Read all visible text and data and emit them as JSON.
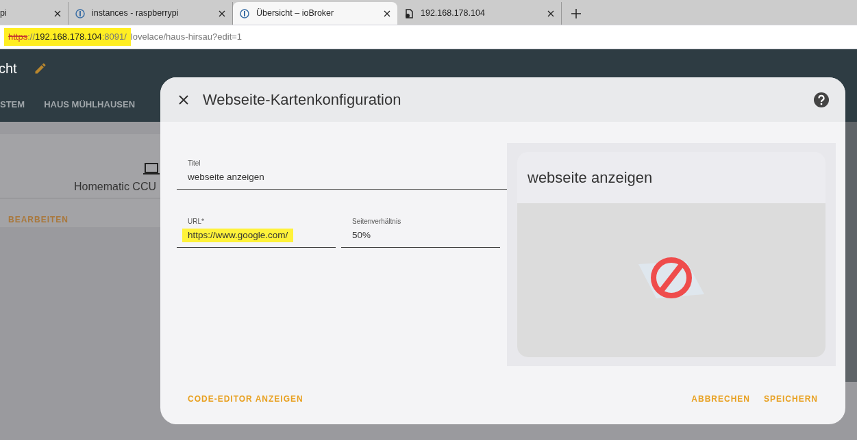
{
  "browser_tabs": [
    {
      "title": "pi",
      "selected": false
    },
    {
      "title": "instances - raspberrypi",
      "kind": "site",
      "selected": false
    },
    {
      "title": "Übersicht – ioBroker",
      "kind": "site",
      "selected": true
    },
    {
      "title": "192.168.178.104",
      "kind": "file",
      "selected": false
    }
  ],
  "address_bar": {
    "scheme": "https",
    "separator": "://",
    "host": "192.168.178.104",
    "port": ":8091",
    "slash": "/",
    "path": "lovelace/haus-hirsau?edit=1",
    "highlighted": true,
    "insecure": true
  },
  "app_header": {
    "title": "cht"
  },
  "view_tabs": [
    {
      "label": "STEM",
      "selected": false
    },
    {
      "label": "HAUS MÜHLHAUSEN",
      "selected": false
    }
  ],
  "background_card": {
    "name": "Homematic CCU",
    "action": "BEARBEITEN"
  },
  "dialog": {
    "title": "Webseite-Kartenkonfiguration",
    "fields": [
      {
        "label": "Titel",
        "value": "webseite anzeigen",
        "highlighted": false
      },
      {
        "label": "URL*",
        "value": "https://www.google.com/",
        "highlighted": true
      },
      {
        "label": "Seitenverhältnis",
        "value": "50%",
        "highlighted": false
      }
    ],
    "preview": {
      "title": "webseite anzeigen"
    },
    "buttons": [
      {
        "label": "CODE-EDITOR ANZEIGEN",
        "kind": "left"
      },
      {
        "label": "ABBRECHEN",
        "kind": "right"
      },
      {
        "label": "SPEICHERN",
        "kind": "right"
      }
    ]
  }
}
